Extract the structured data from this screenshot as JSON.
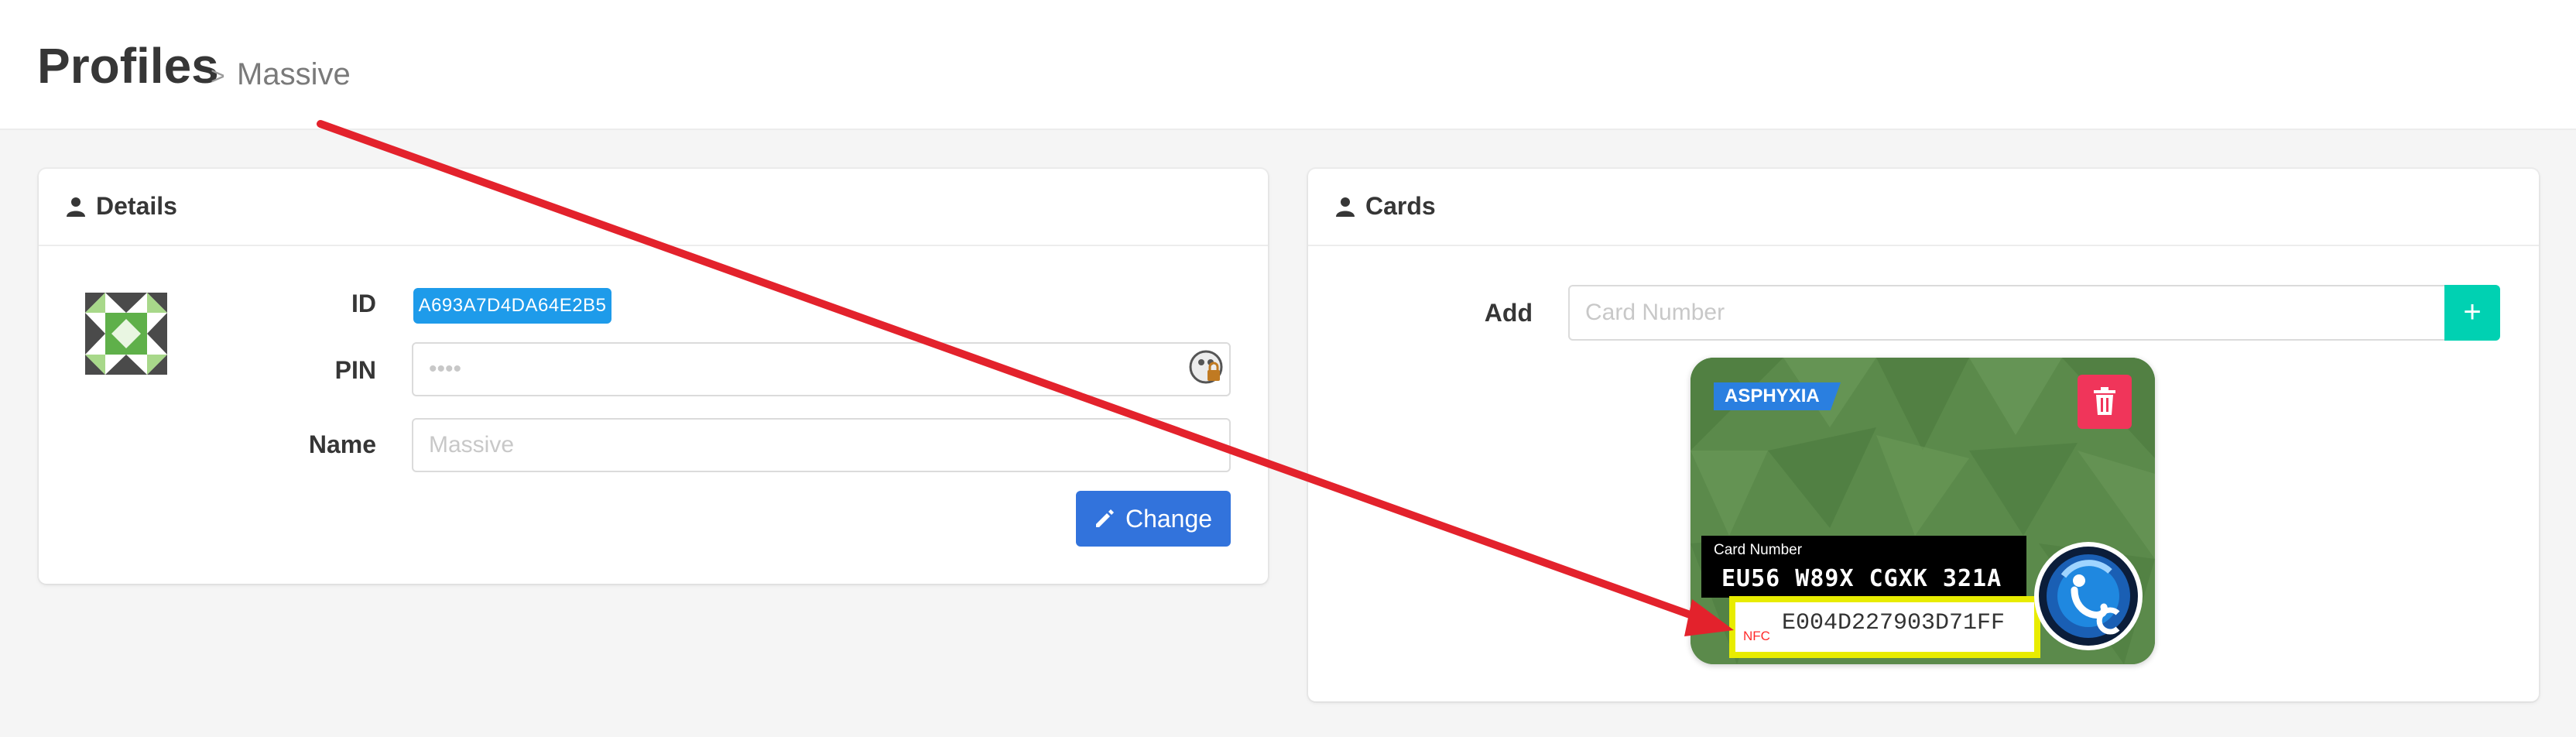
{
  "header": {
    "title": "Profiles",
    "separator": ">",
    "breadcrumb": "Massive"
  },
  "details": {
    "title": "Details",
    "id_label": "ID",
    "id_value": "A693A7D4DA64E2B5",
    "pin_label": "PIN",
    "pin_placeholder": "••••",
    "name_label": "Name",
    "name_placeholder": "Massive",
    "change_button": "Change"
  },
  "cards": {
    "title": "Cards",
    "add_label": "Add",
    "card_number_placeholder": "Card Number",
    "add_button": "+",
    "card": {
      "brand": "ASPHYXIA",
      "number_caption": "Card Number",
      "number": "EU56 W89X CGXK 321A",
      "nfc_label": "NFC",
      "nfc_value": "E004D227903D71FF"
    }
  },
  "colors": {
    "accent_blue": "#3273dc",
    "tag_blue": "#1e9bea",
    "add_teal": "#00d1b2",
    "delete_red": "#f0355a",
    "card_green": "#5b8a4b",
    "highlight_yellow": "#e8ec00",
    "arrow_red": "#e3222c"
  },
  "icons": {
    "user": "user-icon",
    "password_manager": "password-manager-icon",
    "pencil": "pencil-icon",
    "trash": "trash-icon"
  }
}
